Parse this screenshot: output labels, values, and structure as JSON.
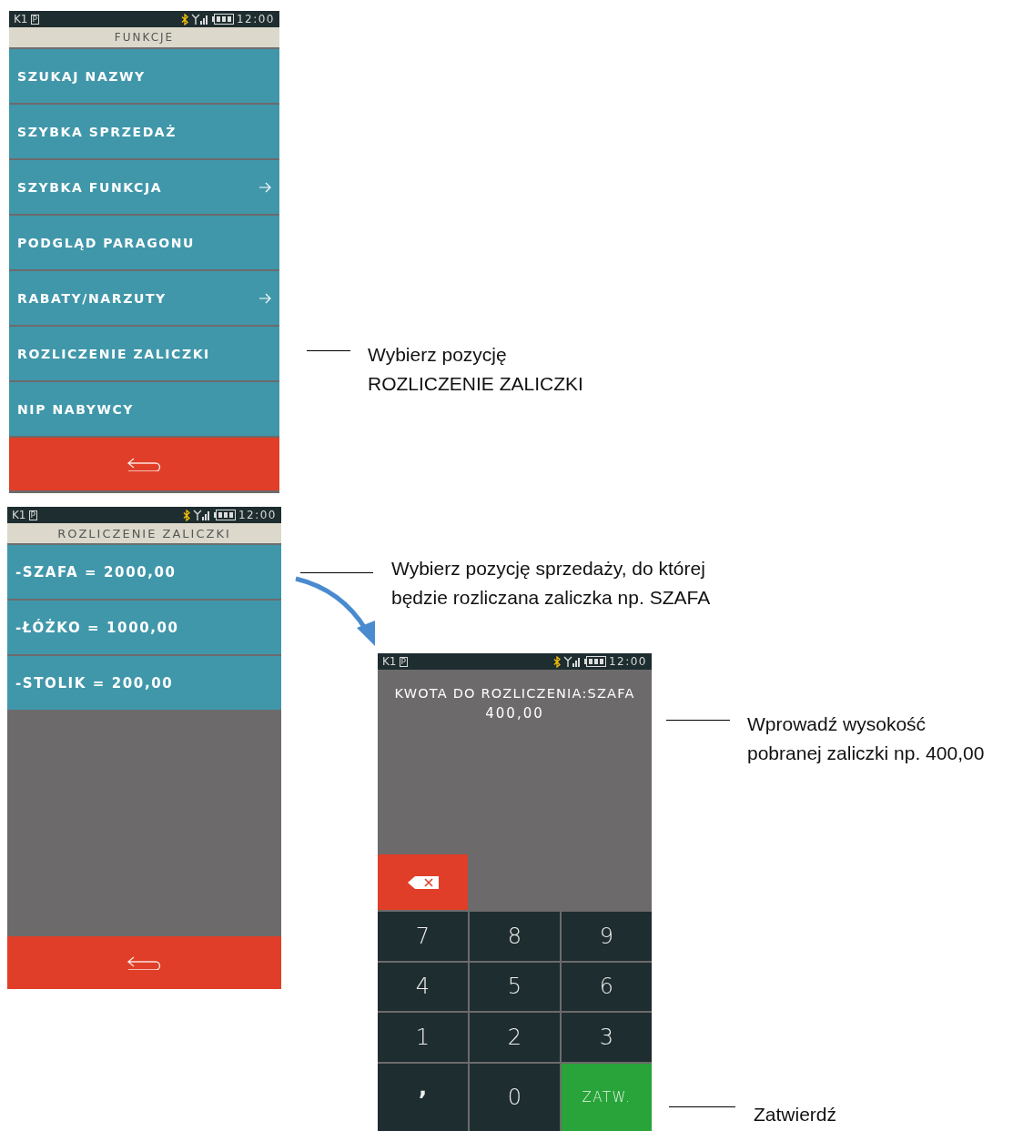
{
  "menu_screen": {
    "status": {
      "terminal": "K1",
      "mode": "P",
      "time": "12:00"
    },
    "title": "FUNKCJE",
    "items": [
      {
        "label": "SZUKAJ NAZWY",
        "submenu": false
      },
      {
        "label": "SZYBKA SPRZEDAŻ",
        "submenu": false
      },
      {
        "label": "SZYBKA FUNKCJA",
        "submenu": true
      },
      {
        "label": "PODGLĄD PARAGONU",
        "submenu": false
      },
      {
        "label": "RABATY/NARZUTY",
        "submenu": true
      },
      {
        "label": "ROZLICZENIE ZALICZKI",
        "submenu": false
      },
      {
        "label": "NIP NABYWCY",
        "submenu": false
      }
    ]
  },
  "list_screen": {
    "status": {
      "terminal": "K1",
      "mode": "P",
      "time": "12:00"
    },
    "title": "ROZLICZENIE ZALICZKI",
    "items": [
      {
        "label": "-SZAFA = 2000,00"
      },
      {
        "label": "-ŁÓŻKO = 1000,00"
      },
      {
        "label": "-STOLIK = 200,00"
      }
    ]
  },
  "amount_screen": {
    "status": {
      "terminal": "K1",
      "mode": "P",
      "time": "12:00"
    },
    "prompt": "KWOTA DO ROZLICZENIA:SZAFA",
    "value": "400,00",
    "keys": [
      {
        "label": "7",
        "kind": "digit"
      },
      {
        "label": "8",
        "kind": "digit"
      },
      {
        "label": "9",
        "kind": "digit"
      },
      {
        "label": "4",
        "kind": "digit"
      },
      {
        "label": "5",
        "kind": "digit"
      },
      {
        "label": "6",
        "kind": "digit"
      },
      {
        "label": "1",
        "kind": "digit"
      },
      {
        "label": "2",
        "kind": "digit"
      },
      {
        "label": "3",
        "kind": "digit"
      },
      {
        "label": ",",
        "kind": "comma"
      },
      {
        "label": "0",
        "kind": "digit"
      },
      {
        "label": "ZATW.",
        "kind": "confirm"
      }
    ]
  },
  "annotations": [
    {
      "lines": [
        "Wybierz pozycję",
        "ROZLICZENIE ZALICZKI"
      ]
    },
    {
      "lines": [
        "Wybierz pozycję sprzedaży, do której",
        "będzie rozliczana zaliczka np. SZAFA"
      ]
    },
    {
      "lines": [
        "Wprowadź wysokość",
        "pobranej zaliczki np. 400,00"
      ]
    },
    {
      "lines": [
        "Zatwierdź"
      ]
    }
  ]
}
